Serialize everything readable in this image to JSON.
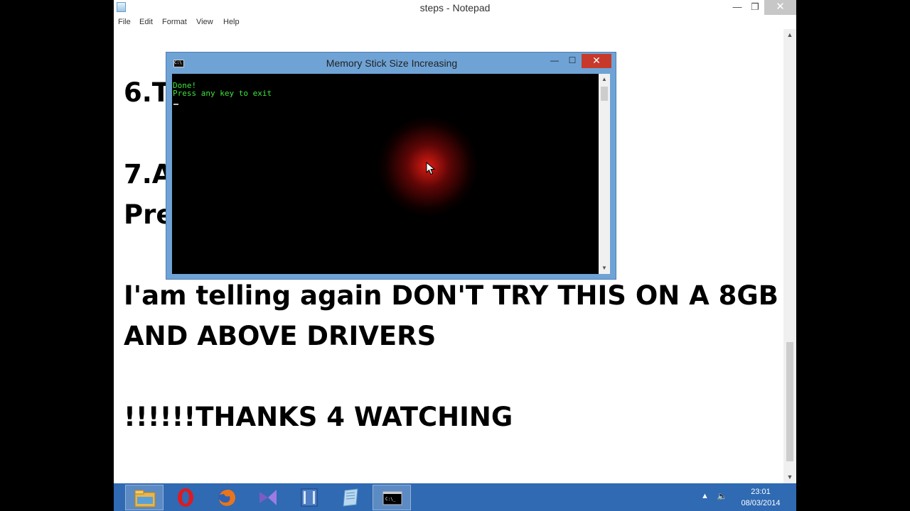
{
  "notepad": {
    "title": "steps - Notepad",
    "controls": {
      "minimize": "—",
      "maximize": "❐",
      "close": "✕"
    },
    "menu": [
      "File",
      "Edit",
      "Format",
      "View",
      "Help"
    ],
    "lines": [
      "6.T",
      "7.A",
      "Pre",
      "I'am telling again DON'T TRY THIS ON A 8GB",
      "AND ABOVE DRIVERS",
      "!!!!!!THANKS 4 WATCHING"
    ]
  },
  "console": {
    "title": "Memory Stick Size Increasing",
    "icon_text": "C:\\",
    "controls": {
      "minimize": "—",
      "maximize": "☐",
      "close": "✕"
    },
    "output": [
      "Done!",
      "Press any key to exit"
    ],
    "text_color": "#3ce63c"
  },
  "taskbar": {
    "apps": [
      {
        "name": "file-explorer-icon"
      },
      {
        "name": "opera-icon"
      },
      {
        "name": "firefox-icon"
      },
      {
        "name": "visual-studio-icon"
      },
      {
        "name": "film-icon"
      },
      {
        "name": "notepad-icon"
      },
      {
        "name": "command-prompt-icon"
      }
    ],
    "clock": {
      "time": "23:01",
      "date": "08/03/2014"
    },
    "tray": {
      "arrow": "▲",
      "volume": "🔈"
    },
    "color": "#2f6ab3"
  }
}
